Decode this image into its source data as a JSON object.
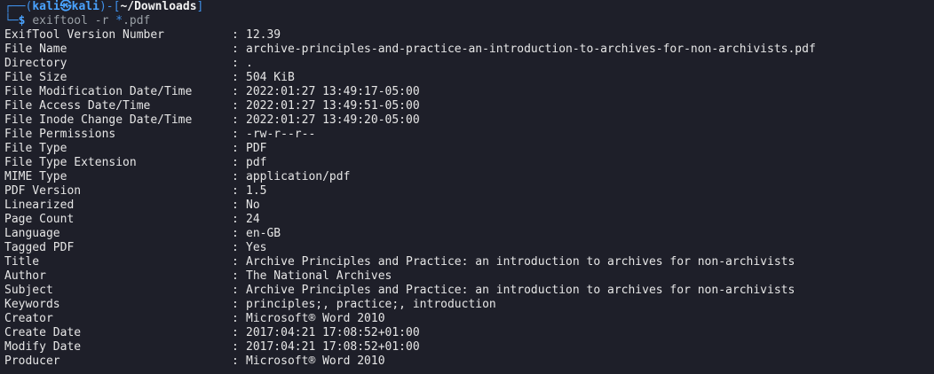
{
  "prompt": {
    "line1_open": "┌──(",
    "user": "kali",
    "at_icon": "㉿",
    "host": "kali",
    "line1_mid": ")-[",
    "cwd": "~/Downloads",
    "line1_close": "]",
    "line2_corner": "└─",
    "dollar": "$",
    "command": "exiftool",
    "flag": "-r",
    "glob_star": "*",
    "glob_ext": ".pdf"
  },
  "separator": ":",
  "rows": [
    {
      "key": "ExifTool Version Number",
      "value": "12.39"
    },
    {
      "key": "File Name",
      "value": "archive-principles-and-practice-an-introduction-to-archives-for-non-archivists.pdf"
    },
    {
      "key": "Directory",
      "value": "."
    },
    {
      "key": "File Size",
      "value": "504 KiB"
    },
    {
      "key": "File Modification Date/Time",
      "value": "2022:01:27 13:49:17-05:00"
    },
    {
      "key": "File Access Date/Time",
      "value": "2022:01:27 13:49:51-05:00"
    },
    {
      "key": "File Inode Change Date/Time",
      "value": "2022:01:27 13:49:20-05:00"
    },
    {
      "key": "File Permissions",
      "value": "-rw-r--r--"
    },
    {
      "key": "File Type",
      "value": "PDF"
    },
    {
      "key": "File Type Extension",
      "value": "pdf"
    },
    {
      "key": "MIME Type",
      "value": "application/pdf"
    },
    {
      "key": "PDF Version",
      "value": "1.5"
    },
    {
      "key": "Linearized",
      "value": "No"
    },
    {
      "key": "Page Count",
      "value": "24"
    },
    {
      "key": "Language",
      "value": "en-GB"
    },
    {
      "key": "Tagged PDF",
      "value": "Yes"
    },
    {
      "key": "Title",
      "value": "Archive Principles and Practice: an introduction to archives for non-archivists"
    },
    {
      "key": "Author",
      "value": "The National Archives"
    },
    {
      "key": "Subject",
      "value": "Archive Principles and Practice: an introduction to archives for non-archivists"
    },
    {
      "key": "Keywords",
      "value": "principles;, practice;, introduction"
    },
    {
      "key": "Creator",
      "value": "Microsoft® Word 2010"
    },
    {
      "key": "Create Date",
      "value": "2017:04:21 17:08:52+01:00"
    },
    {
      "key": "Modify Date",
      "value": "2017:04:21 17:08:52+01:00"
    },
    {
      "key": "Producer",
      "value": "Microsoft® Word 2010"
    }
  ]
}
